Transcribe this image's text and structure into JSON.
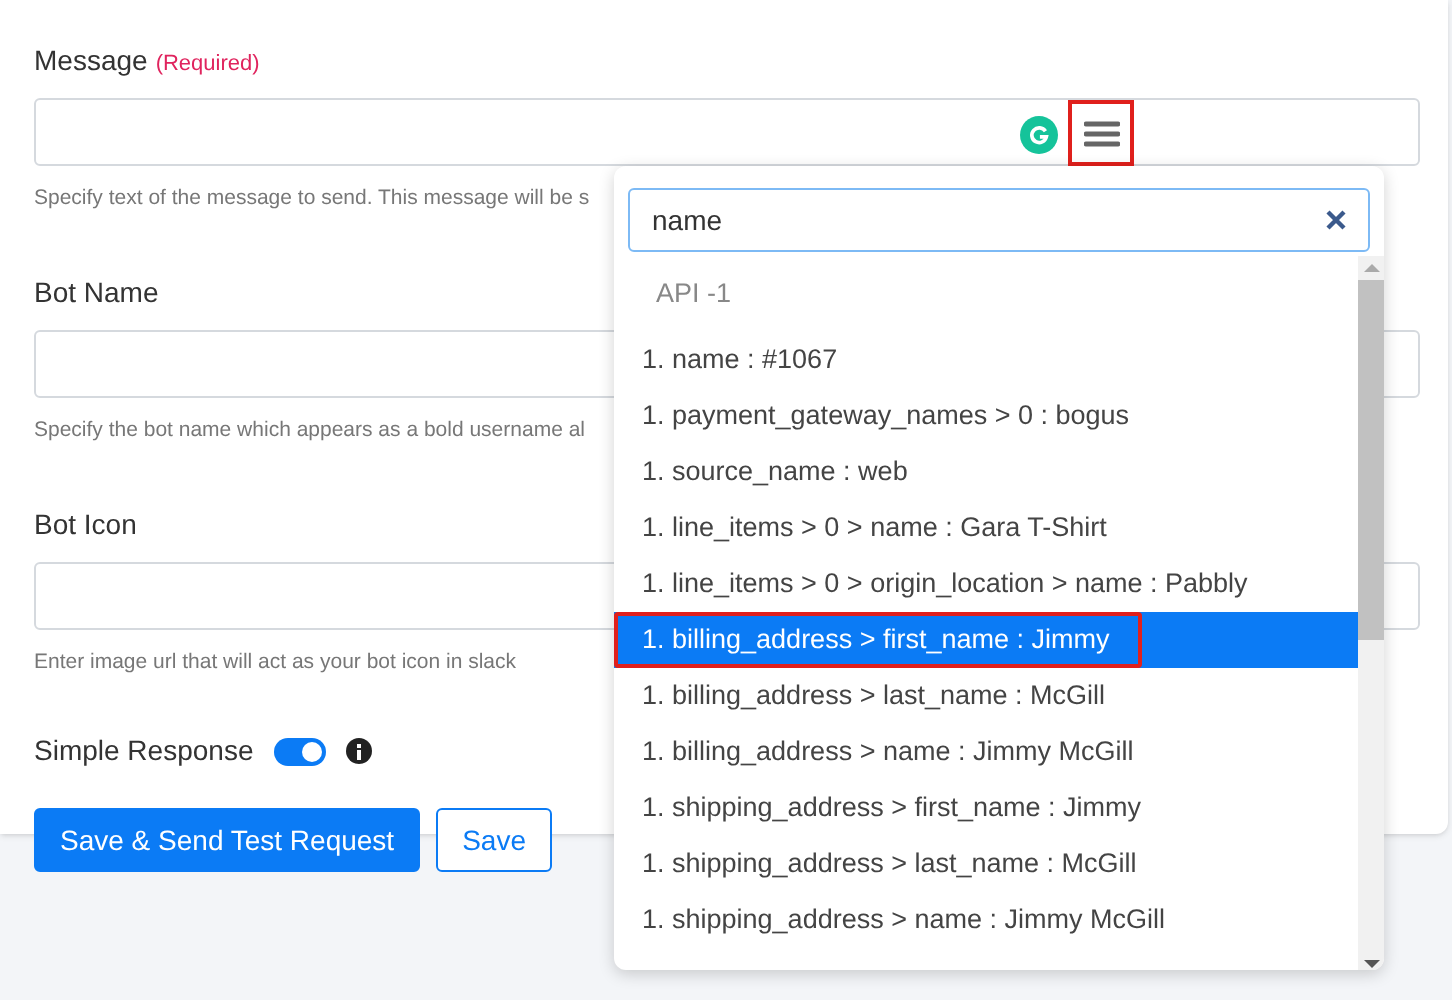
{
  "fields": [
    {
      "label": "Message",
      "required_note": "(Required)",
      "help": "Specify text of the message to send. This message will be s",
      "has_tools": true
    },
    {
      "label": "Bot Name",
      "help": "Specify the bot name which appears as a bold username al"
    },
    {
      "label": "Bot Icon",
      "help": "Enter image url that will act as your bot icon in slack"
    }
  ],
  "simple_response": {
    "label": "Simple Response",
    "on": true
  },
  "buttons": [
    {
      "label": "Save & Send Test Request",
      "kind": "primary"
    },
    {
      "label": "Save",
      "kind": "outline"
    }
  ],
  "dropdown": {
    "search_value": "name",
    "group": "API -1",
    "items": [
      {
        "label": "1. name : #1067",
        "selected": false
      },
      {
        "label": "1. payment_gateway_names > 0 : bogus",
        "selected": false
      },
      {
        "label": "1. source_name : web",
        "selected": false
      },
      {
        "label": "1. line_items > 0 > name : Gara T-Shirt",
        "selected": false
      },
      {
        "label": "1. line_items > 0 > origin_location > name : Pabbly",
        "selected": false
      },
      {
        "label": "1. billing_address > first_name : Jimmy",
        "selected": true
      },
      {
        "label": "1. billing_address > last_name : McGill",
        "selected": false
      },
      {
        "label": "1. billing_address > name : Jimmy McGill",
        "selected": false
      },
      {
        "label": "1. shipping_address > first_name : Jimmy",
        "selected": false
      },
      {
        "label": "1. shipping_address > last_name : McGill",
        "selected": false
      },
      {
        "label": "1. shipping_address > name : Jimmy McGill",
        "selected": false
      }
    ]
  }
}
